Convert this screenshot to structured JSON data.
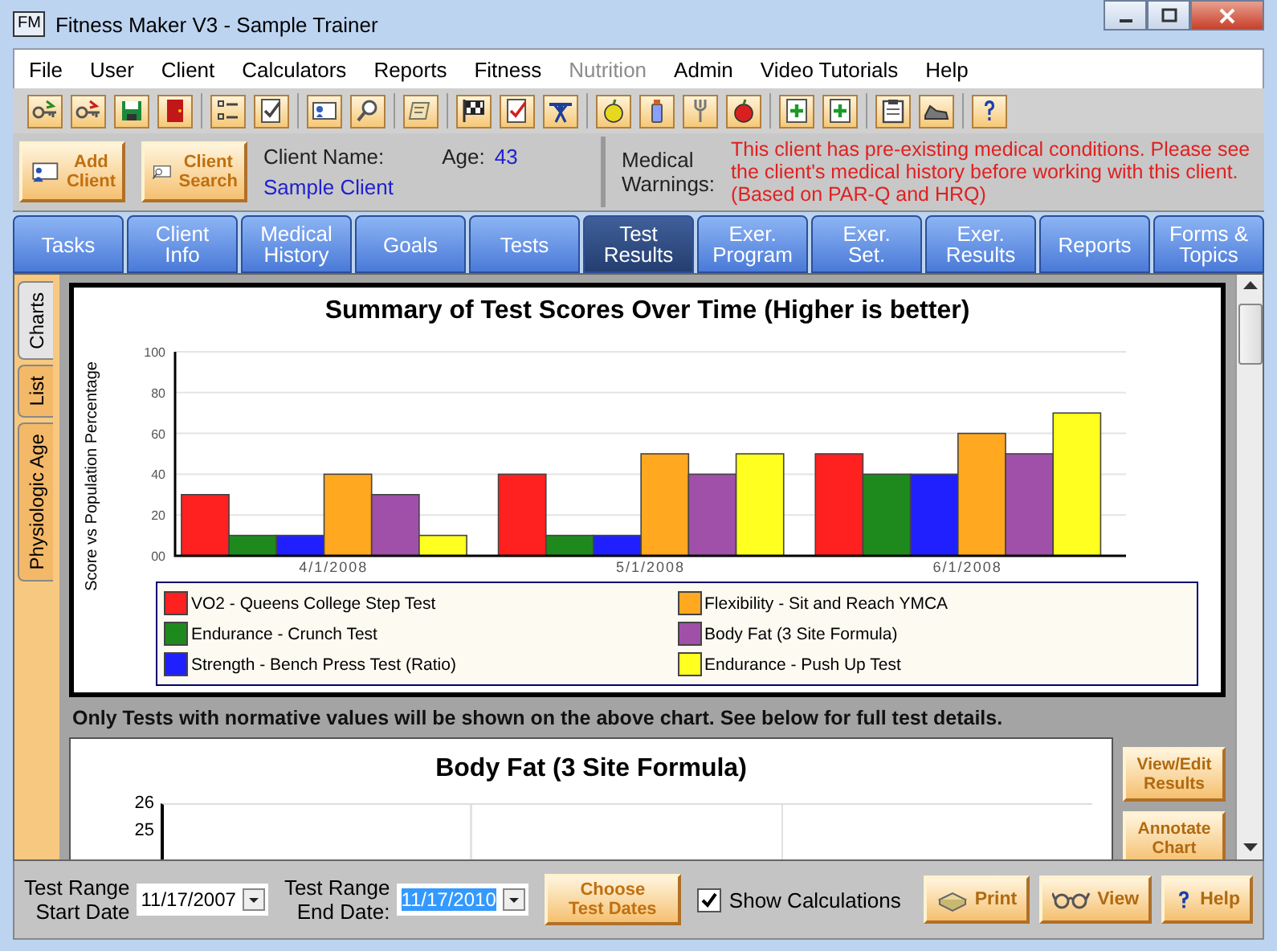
{
  "window": {
    "title": "Fitness Maker V3 - Sample Trainer",
    "app_icon": "FM"
  },
  "menu": [
    {
      "label": "File",
      "disabled": false
    },
    {
      "label": "User",
      "disabled": false
    },
    {
      "label": "Client",
      "disabled": false
    },
    {
      "label": "Calculators",
      "disabled": false
    },
    {
      "label": "Reports",
      "disabled": false
    },
    {
      "label": "Fitness",
      "disabled": false
    },
    {
      "label": "Nutrition",
      "disabled": true
    },
    {
      "label": "Admin",
      "disabled": false
    },
    {
      "label": "Video Tutorials",
      "disabled": false
    },
    {
      "label": "Help",
      "disabled": false
    }
  ],
  "client_bar": {
    "buttons": [
      {
        "kind": "add",
        "label": "Add\nClient"
      },
      {
        "kind": "search",
        "label": "Client\nSearch"
      }
    ],
    "client_name_label": "Client Name:",
    "client_name": "Sample Client",
    "age_label": "Age:",
    "age": "43",
    "warnings_label": "Medical\nWarnings:",
    "warning": "This client has pre-existing medical conditions. Please see the client's medical history before working with this client.  (Based on PAR-Q and HRQ)"
  },
  "tabs": [
    {
      "label": "Tasks",
      "selected": false
    },
    {
      "label": "Client\nInfo",
      "selected": false
    },
    {
      "label": "Medical\nHistory",
      "selected": false
    },
    {
      "label": "Goals",
      "selected": false
    },
    {
      "label": "Tests",
      "selected": false
    },
    {
      "label": "Test\nResults",
      "selected": true
    },
    {
      "label": "Exer.\nProgram",
      "selected": false
    },
    {
      "label": "Exer.\nSet.",
      "selected": false
    },
    {
      "label": "Exer.\nResults",
      "selected": false
    },
    {
      "label": "Reports",
      "selected": false
    },
    {
      "label": "Forms &\nTopics",
      "selected": false
    }
  ],
  "side_tabs": [
    {
      "label": "Charts",
      "selected": true
    },
    {
      "label": "List",
      "selected": false
    },
    {
      "label": "Physiologic Age",
      "selected": false
    }
  ],
  "summary_chart": {
    "chart_data": {
      "type": "bar",
      "title": "Summary of Test Scores Over Time (Higher is better)",
      "ylabel": "Score vs Population Percentage",
      "categories": [
        "4/1/2008",
        "5/1/2008",
        "6/1/2008"
      ],
      "ylim": [
        0,
        100
      ],
      "grid": true,
      "legend": "bottom",
      "yticks": [
        {
          "value": 0,
          "label": "00"
        },
        20,
        40,
        60,
        80,
        100
      ],
      "series": [
        {
          "name": "VO2 - Queens College Step Test",
          "color": "#ff2020",
          "values": [
            30,
            40,
            50
          ]
        },
        {
          "name": "Endurance - Crunch Test",
          "color": "#1e8a1e",
          "values": [
            10,
            10,
            40
          ]
        },
        {
          "name": "Strength - Bench Press Test  (Ratio)",
          "color": "#2020ff",
          "values": [
            10,
            10,
            40
          ]
        },
        {
          "name": "Flexibility - Sit and Reach YMCA",
          "color": "#ffa820",
          "values": [
            40,
            50,
            60
          ]
        },
        {
          "name": "Body Fat (3 Site Formula)",
          "color": "#a050a8",
          "values": [
            30,
            40,
            50
          ]
        },
        {
          "name": "Endurance - Push Up Test",
          "color": "#ffff20",
          "values": [
            10,
            50,
            70
          ]
        }
      ]
    }
  },
  "note": "Only Tests with normative values will be shown on the above chart. See below for full test details.",
  "body_fat_chart": {
    "title": "Body Fat (3 Site Formula)",
    "y_tick_labels": [
      "26",
      "25"
    ]
  },
  "side_buttons": [
    "View/Edit\nResults",
    "Annotate\nChart"
  ],
  "bottom_bar": {
    "start_label": "Test Range\nStart Date",
    "start_date": "11/17/2007",
    "end_label": "Test Range\nEnd Date:",
    "end_date": "11/17/2010",
    "end_date_highlighted": true,
    "choose_button": "Choose\nTest Dates",
    "show_calculations": {
      "label": "Show Calculations",
      "checked": true
    },
    "buttons": [
      {
        "kind": "print",
        "label": "Print"
      },
      {
        "kind": "view",
        "label": "View"
      },
      {
        "kind": "help",
        "label": "Help"
      }
    ]
  }
}
